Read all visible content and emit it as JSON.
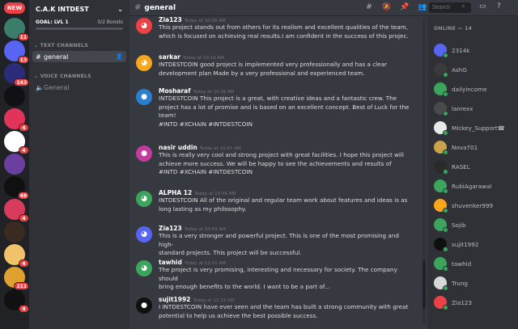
{
  "rail": {
    "new_label": "NEW",
    "servers": [
      {
        "icon": "server-icon",
        "color": "#3a7d6a",
        "badge": "11"
      },
      {
        "icon": "server-icon",
        "color": "#5865f2",
        "badge": "13"
      },
      {
        "icon": "server-icon",
        "color": "#2b2d7a",
        "badge": "143"
      },
      {
        "icon": "server-icon",
        "color": "#101015",
        "badge": ""
      },
      {
        "icon": "server-icon",
        "color": "#e2335a",
        "badge": "4"
      },
      {
        "icon": "server-icon",
        "color": "#ffffff",
        "badge": "4"
      },
      {
        "icon": "server-icon",
        "color": "#6b3fa0",
        "badge": ""
      },
      {
        "icon": "server-icon",
        "color": "#101010",
        "badge": "48"
      },
      {
        "icon": "server-icon",
        "color": "#d93b5c",
        "badge": "4"
      },
      {
        "icon": "server-icon",
        "color": "#3b2a20",
        "badge": ""
      },
      {
        "icon": "server-icon",
        "color": "#f0c26a",
        "badge": "4"
      },
      {
        "icon": "server-icon",
        "color": "#e0a030",
        "badge": "211"
      },
      {
        "icon": "server-icon",
        "color": "#111111",
        "badge": "4"
      }
    ]
  },
  "sidebar": {
    "server_name": "C.A.K INTDEST",
    "goal_label": "GOAL: LVL 1",
    "goal_boosts": "0/2 Boosts",
    "text_category": "TEXT CHANNELS",
    "text_channel": "general",
    "voice_category": "VOICE CHANNELS",
    "voice_channel": "General"
  },
  "topbar": {
    "channel": "general",
    "search_placeholder": "Search"
  },
  "messages": [
    {
      "author": "Zia123",
      "time": "Today at 10:00 AM",
      "avatar_color": "#ed4245",
      "avatar_icon": "discord-icon",
      "lines": [
        "This project stands out from others for its realism and excellent qualities of the team,",
        "which is focused on achieving real results.I am confident in the success of this projec."
      ]
    },
    {
      "author": "sarkar",
      "time": "Today at 10:19 AM",
      "avatar_color": "#faa61a",
      "avatar_icon": "discord-icon",
      "lines": [
        "INTDESTCOIN good project is implemented very professionally and has a clear",
        "development plan Made by a very professional and experienced team."
      ]
    },
    {
      "author": "Mosharaf",
      "time": "Today at 10:26 AM",
      "avatar_color": "#2b7fd0",
      "avatar_icon": "user-avatar",
      "lines": [
        "INTDESTCOIN This project is a great, with creative ideas and a fantastic crew. The",
        "project has a lot of promise and is based on an excellent concept. Best of Luck for the",
        "team!",
        "#INTD #XCHAIN  #INTDESTCOIN"
      ]
    },
    {
      "author": "nasir uddin",
      "time": "Today at 10:47 AM",
      "avatar_color": "#c43ba0",
      "avatar_icon": "user-avatar",
      "lines": [
        "This is really very cool and strong project with great facilities. I hope this project will",
        "achieve more success. We will be happy to see the achievements and results of",
        "#INTD #XCHAIN  #INTDESTCOIN"
      ]
    },
    {
      "author": "ALPHA 12",
      "time": "Today at 10:56 AM",
      "avatar_color": "#3ba55d",
      "avatar_icon": "discord-icon",
      "lines": [
        "INTDESTCOIN All of the original and regular team work about features and ideas is as",
        "long lasting as my philosophy."
      ]
    },
    {
      "author": "Zia123",
      "time": "Today at 10:59 AM",
      "avatar_color": "#5865f2",
      "avatar_icon": "discord-icon",
      "lines": [
        "This is a very stronger and powerful project. This is one of the most promising and high-",
        "standard projects. This project will be successful."
      ]
    },
    {
      "author": "tawhid",
      "time": "Today at 11:11 AM",
      "avatar_color": "#3ba55d",
      "avatar_icon": "discord-icon",
      "lines": [
        "The project is very promising, interesting and necessary for society. The company should",
        "bring enough benefits to the world. I want to be a part of..."
      ]
    },
    {
      "author": "sujit1992",
      "time": "Today at 11:13 AM",
      "avatar_color": "#101010",
      "avatar_icon": "user-avatar",
      "lines": [
        "I  INTDESTCOIN have ever seen and the team has built a strong community with great",
        "potential to help us achieve the best possible success."
      ]
    }
  ],
  "members": {
    "header": "ONLINE — 14",
    "list": [
      {
        "name": "2314k",
        "color": "#5865f2"
      },
      {
        "name": "AshG",
        "color": "#3a3a3a"
      },
      {
        "name": "dailyincome",
        "color": "#3ba55d"
      },
      {
        "name": "lanrexx",
        "color": "#4a4a4a"
      },
      {
        "name": "Mickey_Support☎",
        "color": "#e8e8e8"
      },
      {
        "name": "Nova701",
        "color": "#c9a24a"
      },
      {
        "name": "RASEL",
        "color": "#2a2a2a"
      },
      {
        "name": "RubiAgarawal",
        "color": "#3ba55d"
      },
      {
        "name": "shuvenker999",
        "color": "#faa61a"
      },
      {
        "name": "Sojib",
        "color": "#3ba55d"
      },
      {
        "name": "sujit1992",
        "color": "#101010"
      },
      {
        "name": "tawhid",
        "color": "#3ba55d"
      },
      {
        "name": "Trung",
        "color": "#d8d8d8"
      },
      {
        "name": "Zia123",
        "color": "#ed4245"
      }
    ]
  }
}
